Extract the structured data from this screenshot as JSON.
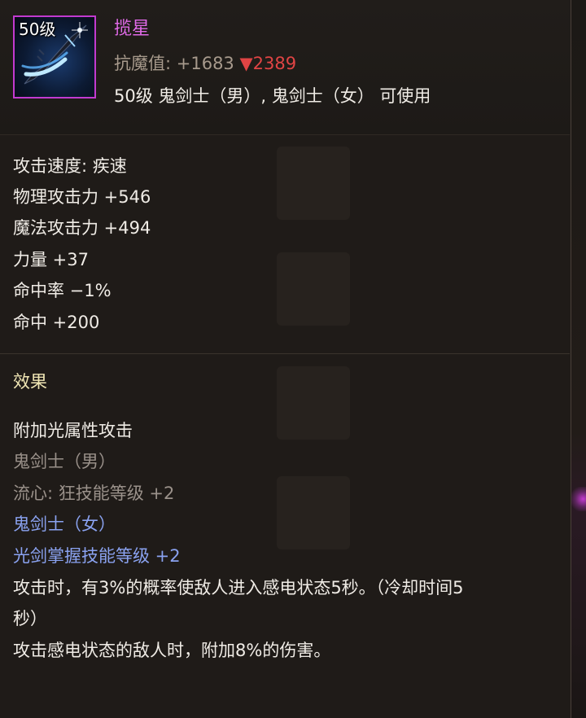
{
  "item": {
    "level_badge": "50级",
    "name": "揽星",
    "anti_magic_label": "抗魔值:",
    "anti_magic_value": " +1683 ",
    "anti_magic_diff": "▼2389",
    "requirement": "50级 鬼剑士（男）, 鬼剑士（女） 可使用",
    "icon": "sword-icon"
  },
  "stats": [
    "攻击速度: 疾速",
    "物理攻击力 +546",
    "魔法攻击力 +494",
    "力量 +37",
    "命中率 −1%",
    "命中 +200"
  ],
  "effect": {
    "title": "效果",
    "line1": "附加光属性攻击",
    "male_class": "鬼剑士（男）",
    "male_skill": "流心: 狂技能等级 +2",
    "female_class": "鬼剑士（女）",
    "female_skill": "光剑掌握技能等级 +2",
    "desc1a": "攻击时，有3%的概率使敌人进入感电状态5秒。（冷却时间5",
    "desc1b": "秒）",
    "desc2": "攻击感电状态的敌人时，附加8%的伤害。"
  },
  "colors": {
    "item_name": "#e06ae8",
    "rarity_border": "#c23ad0",
    "decrease": "#e04444",
    "female_class": "#8aa2f0",
    "effect_title": "#f0e6b4"
  }
}
